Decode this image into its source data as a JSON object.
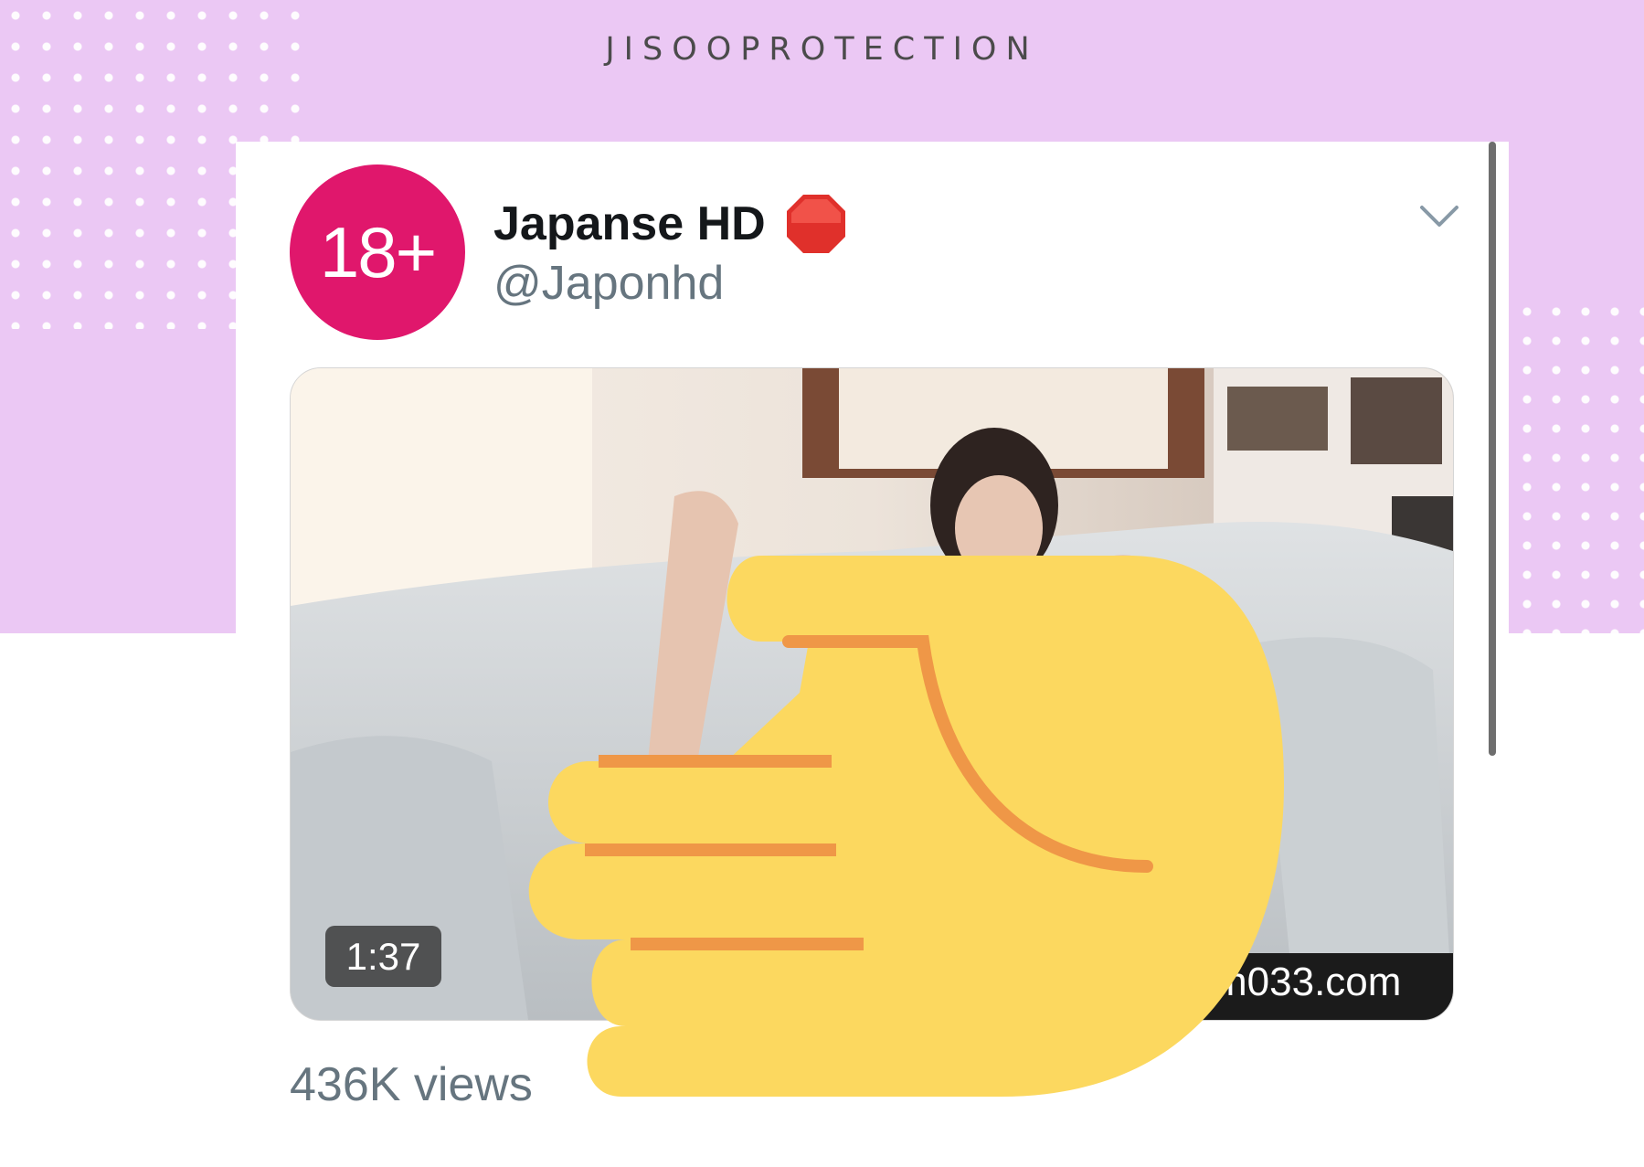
{
  "banner": {
    "watermark": "JISOOPROTECTION"
  },
  "tweet": {
    "avatar_text": "18+",
    "display_name": "Japanse HD",
    "handle": "@Japonhd",
    "name_badge_icon": "stop-sign-icon",
    "menu_icon": "chevron-down-icon",
    "video": {
      "duration": "1:37",
      "watermark_text": "m033.com",
      "cover_icon": "raised-back-of-hand-emoji"
    },
    "views": "436K views"
  },
  "colors": {
    "banner_bg": "#ebc8f4",
    "avatar_bg": "#e0176c",
    "stop_sign": "#e0302b",
    "hand_fill": "#fcd85f",
    "hand_line": "#ef9747",
    "secondary_text": "#66757f"
  }
}
